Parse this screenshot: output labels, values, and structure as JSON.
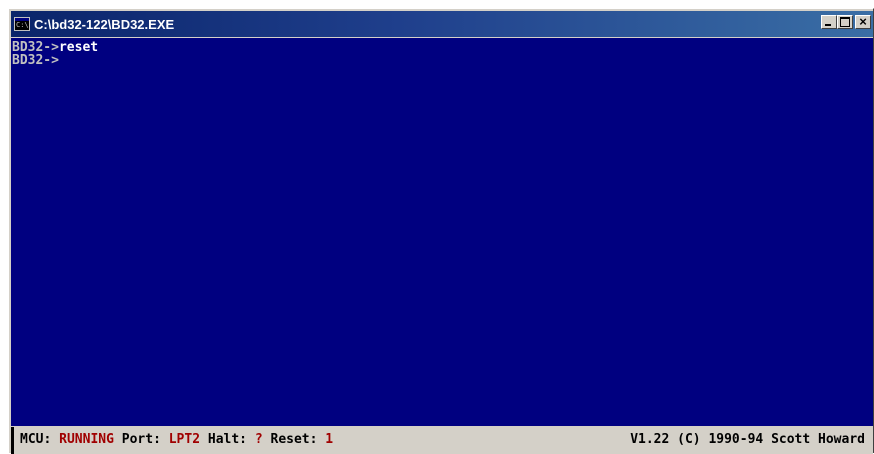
{
  "window": {
    "title": "C:\\bd32-122\\BD32.EXE",
    "icon_text": "C:\\",
    "close_glyph": "×"
  },
  "console": {
    "lines": [
      {
        "prompt": "BD32->",
        "command": "reset"
      },
      {
        "prompt": "BD32->",
        "command": ""
      }
    ]
  },
  "statusbar": {
    "mcu_label": "MCU:",
    "mcu_value": "RUNNING",
    "port_label": "Port:",
    "port_value": "LPT2",
    "halt_label": "Halt:",
    "halt_value": "?",
    "reset_label": "Reset:",
    "reset_value": "1",
    "version": "V1.22 (C) 1990-94 Scott Howard"
  },
  "colors": {
    "console_bg": "#000080",
    "console_text": "#c0c0c0",
    "status_value": "#a00000",
    "titlebar": "#0a246a"
  }
}
